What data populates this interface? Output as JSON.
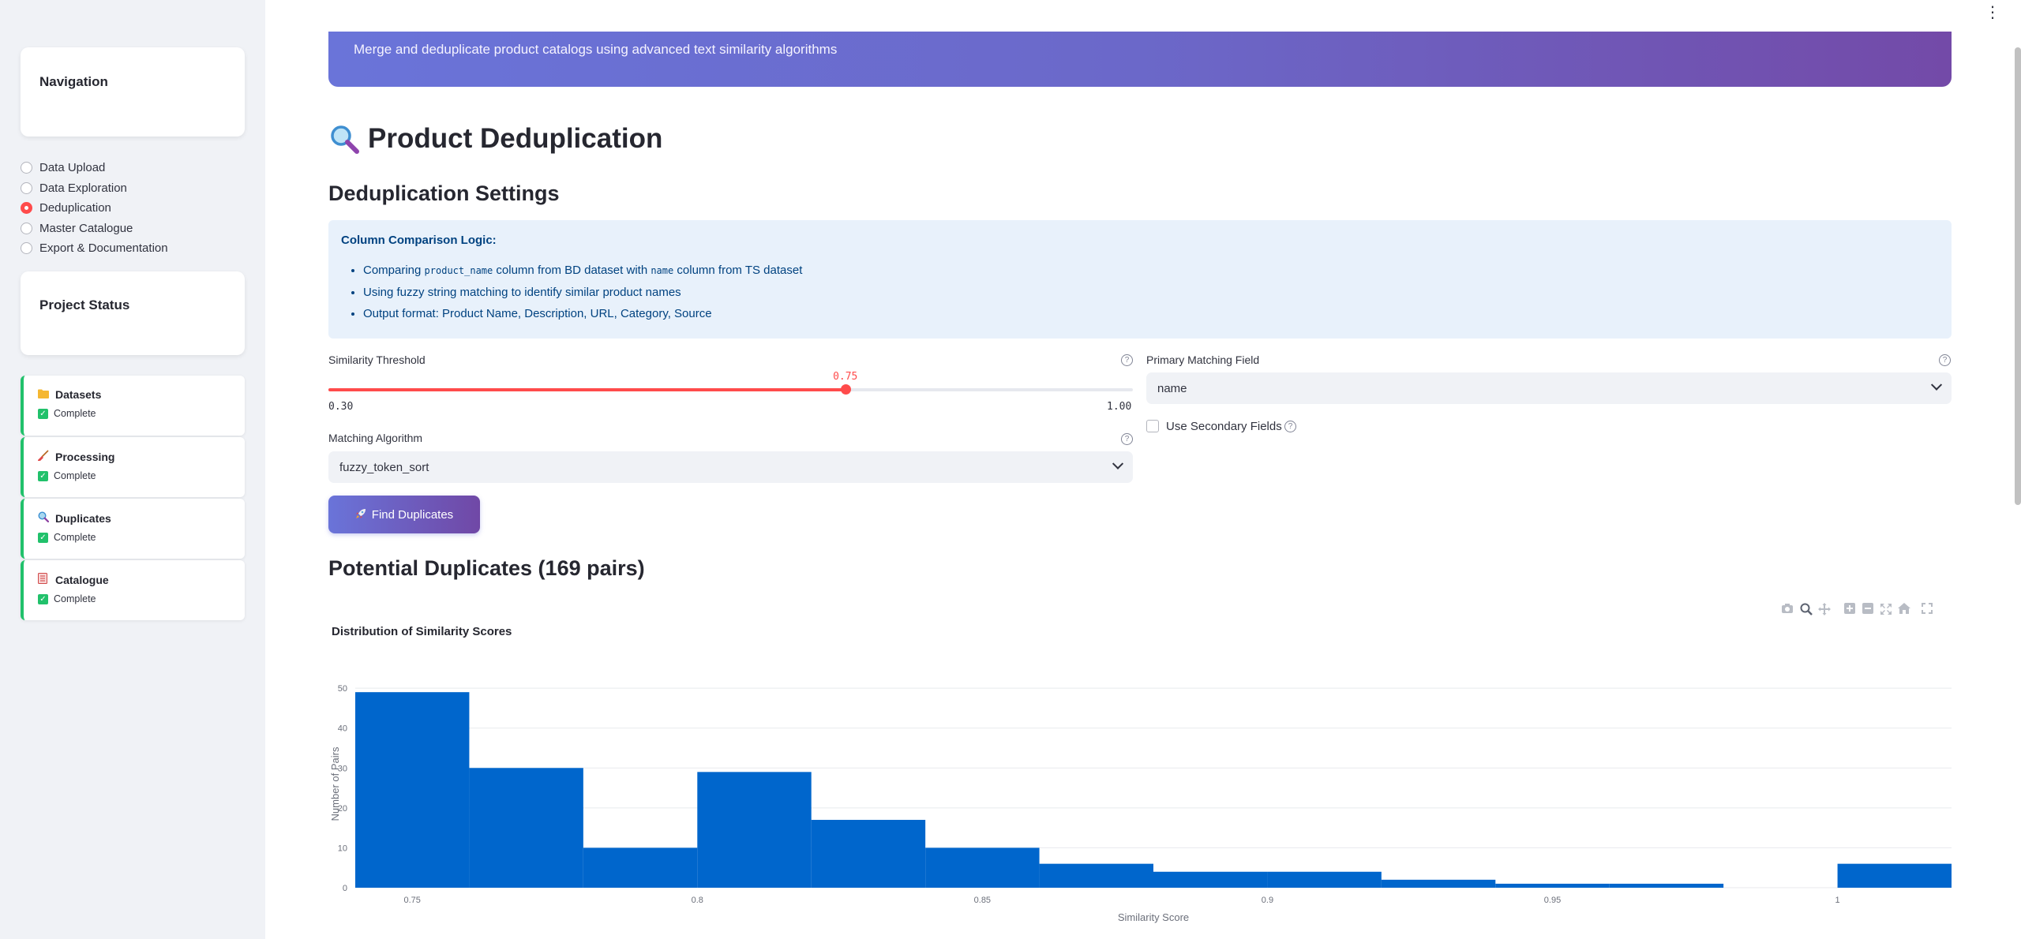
{
  "sidebar": {
    "navigation_title": "Navigation",
    "nav_items": [
      {
        "label": "Data Upload",
        "selected": false
      },
      {
        "label": "Data Exploration",
        "selected": false
      },
      {
        "label": "Deduplication",
        "selected": true
      },
      {
        "label": "Master Catalogue",
        "selected": false
      },
      {
        "label": "Export & Documentation",
        "selected": false
      }
    ],
    "status_title": "Project Status",
    "steps": [
      {
        "title": "Datasets",
        "icon": "folder-icon",
        "status": "Complete"
      },
      {
        "title": "Processing",
        "icon": "broom-icon",
        "status": "Complete"
      },
      {
        "title": "Duplicates",
        "icon": "magnifier-icon",
        "status": "Complete"
      },
      {
        "title": "Catalogue",
        "icon": "ledger-icon",
        "status": "Complete"
      }
    ]
  },
  "header": {
    "subtitle": "Merge and deduplicate product catalogs using advanced text similarity algorithms"
  },
  "page": {
    "title": "Product Deduplication",
    "settings_heading": "Deduplication Settings",
    "info": {
      "title": "Column Comparison Logic:",
      "line1_a": "Comparing ",
      "line1_code1": "product_name",
      "line1_b": " column from BD dataset with ",
      "line1_code2": "name",
      "line1_c": " column from TS dataset",
      "line2": "Using fuzzy string matching to identify similar product names",
      "line3": "Output format: Product Name, Description, URL, Category, Source"
    },
    "threshold": {
      "label": "Similarity Threshold",
      "value": 0.75,
      "value_text": "0.75",
      "min": 0.3,
      "min_text": "0.30",
      "max": 1.0,
      "max_text": "1.00"
    },
    "algorithm": {
      "label": "Matching Algorithm",
      "value": "fuzzy_token_sort"
    },
    "primary_field": {
      "label": "Primary Matching Field",
      "value": "name"
    },
    "secondary": {
      "label": "Use Secondary Fields",
      "checked": false
    },
    "find_button": "Find Duplicates",
    "results_heading": "Potential Duplicates (169 pairs)"
  },
  "colors": {
    "accent": "#ff4b4b",
    "bar": "#0066cc",
    "success": "#21c16b",
    "hero_start": "#6a74d9",
    "hero_end": "#734aa8"
  },
  "chart_data": {
    "type": "bar",
    "title": "Distribution of Similarity Scores",
    "xlabel": "Similarity Score",
    "ylabel": "Number of Pairs",
    "bin_width": 0.02,
    "bins": [
      {
        "x0": 0.74,
        "x1": 0.76,
        "count": 49
      },
      {
        "x0": 0.76,
        "x1": 0.78,
        "count": 30
      },
      {
        "x0": 0.78,
        "x1": 0.8,
        "count": 10
      },
      {
        "x0": 0.8,
        "x1": 0.82,
        "count": 29
      },
      {
        "x0": 0.82,
        "x1": 0.84,
        "count": 17
      },
      {
        "x0": 0.84,
        "x1": 0.86,
        "count": 10
      },
      {
        "x0": 0.86,
        "x1": 0.88,
        "count": 6
      },
      {
        "x0": 0.88,
        "x1": 0.9,
        "count": 4
      },
      {
        "x0": 0.9,
        "x1": 0.92,
        "count": 4
      },
      {
        "x0": 0.92,
        "x1": 0.94,
        "count": 2
      },
      {
        "x0": 0.94,
        "x1": 0.96,
        "count": 1
      },
      {
        "x0": 0.96,
        "x1": 0.98,
        "count": 1
      },
      {
        "x0": 0.98,
        "x1": 1.0,
        "count": 0
      },
      {
        "x0": 1.0,
        "x1": 1.02,
        "count": 6
      }
    ],
    "xlim": [
      0.74,
      1.02
    ],
    "ylim": [
      0,
      52
    ],
    "x_ticks": [
      0.75,
      0.8,
      0.85,
      0.9,
      0.95,
      1
    ],
    "x_tick_labels": [
      "0.75",
      "0.8",
      "0.85",
      "0.9",
      "0.95",
      "1"
    ],
    "y_ticks": [
      0,
      10,
      20,
      30,
      40,
      50
    ],
    "y_tick_labels": [
      "0",
      "10",
      "20",
      "30",
      "40",
      "50"
    ],
    "grid": true,
    "legend": "none"
  },
  "modebar": [
    "camera-icon",
    "zoom-icon",
    "pan-icon",
    "zoom-in-icon",
    "zoom-out-icon",
    "autoscale-icon",
    "reset-axes-icon",
    "fullscreen-icon"
  ]
}
